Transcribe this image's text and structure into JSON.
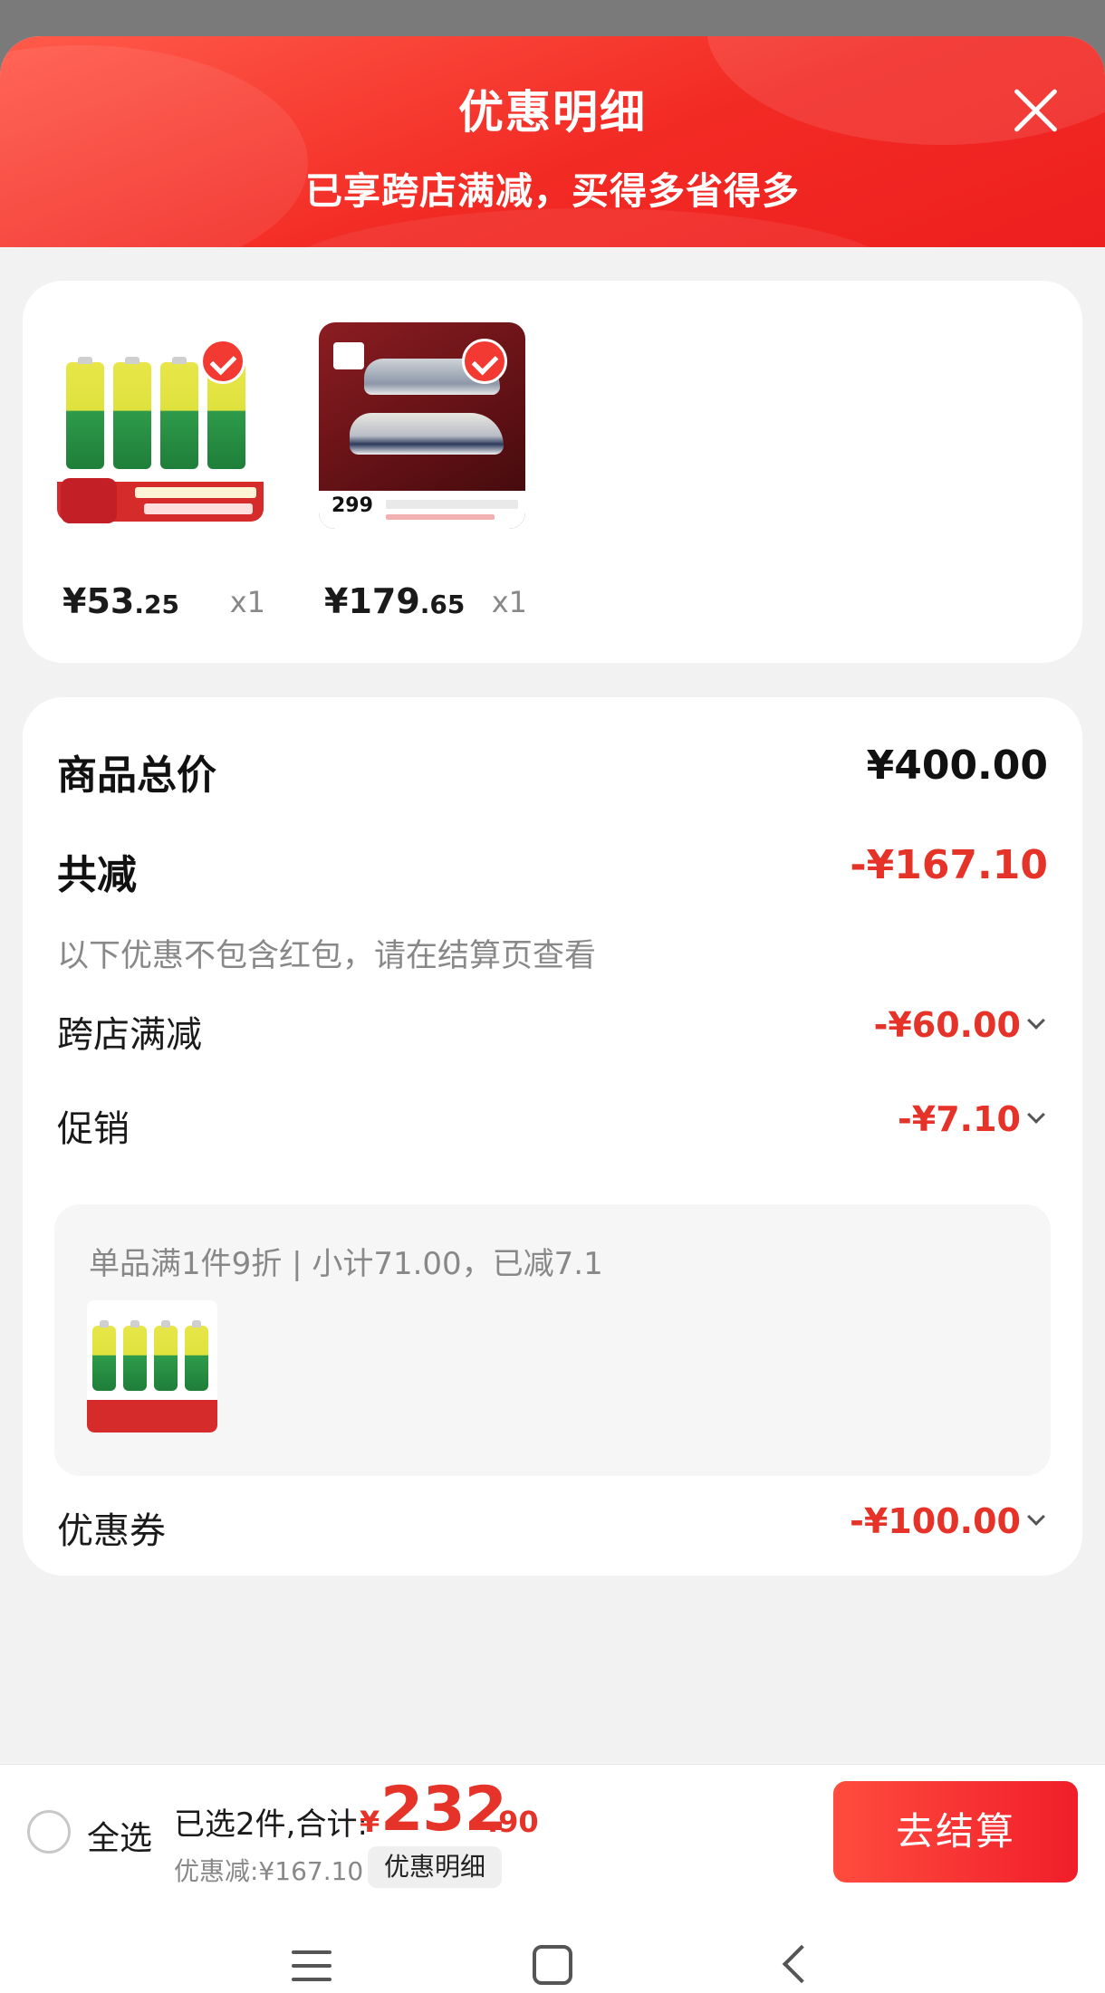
{
  "header": {
    "title": "优惠明细",
    "subtitle": "已享跨店满减，买得多省得多"
  },
  "products": [
    {
      "price_int": "¥53",
      "price_dec": ".25",
      "qty": "x1",
      "image": "battery"
    },
    {
      "price_int": "¥179",
      "price_dec": ".65",
      "qty": "x1",
      "image": "shoe",
      "banner_price": "299"
    }
  ],
  "summary": {
    "total_label": "商品总价",
    "total_value": "¥400.00",
    "reduce_label": "共减",
    "reduce_value": "-¥167.10",
    "note": "以下优惠不包含红包，请在结算页查看",
    "cross_store_label": "跨店满减",
    "cross_store_value": "-¥60.00",
    "promo_label": "促销",
    "promo_value": "-¥7.10",
    "promo_detail": "单品满1件9折 | 小计71.00，已减7.1",
    "coupon_label": "优惠券",
    "coupon_value": "-¥100.00"
  },
  "bottom_bar": {
    "select_all": "全选",
    "selected_text": "已选2件,合计:",
    "total_symbol": "¥",
    "total_int": "232",
    "total_dec": ".90",
    "discount_text": "优惠减:¥167.10",
    "detail_button": "优惠明细",
    "checkout_button": "去结算"
  },
  "colors": {
    "accent": "#e63329",
    "header_red": "#f22a24"
  },
  "icons": [
    "close-icon",
    "check-icon",
    "chevron-down-icon",
    "menu-icon",
    "home-icon",
    "back-icon"
  ]
}
